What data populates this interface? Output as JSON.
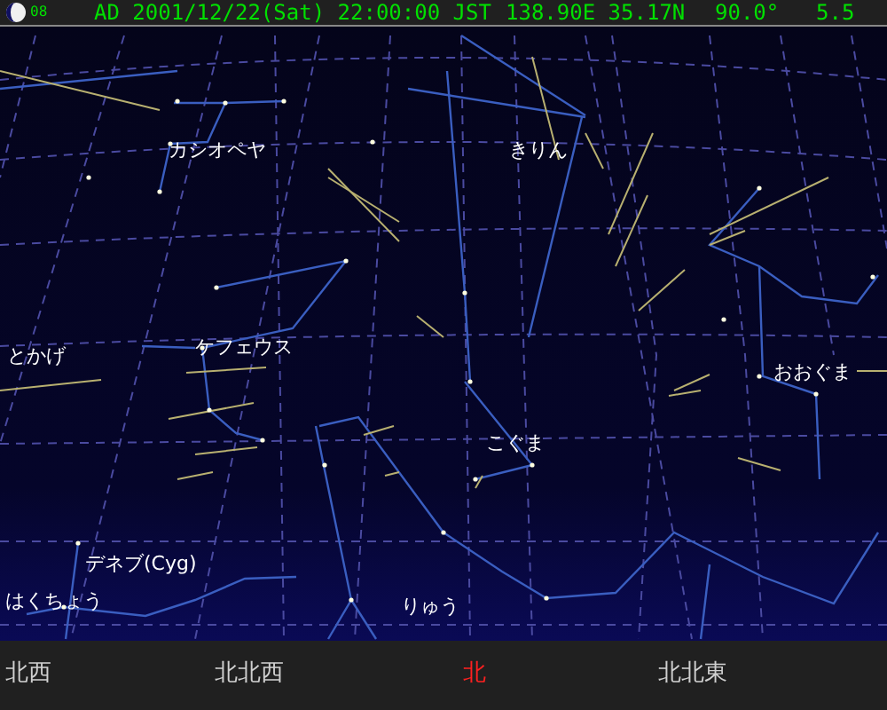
{
  "status_bar": {
    "moon_age": "08",
    "datetime": "AD 2001/12/22(Sat) 22:00:00 JST",
    "location": "138.90E 35.17N",
    "direction": "90.0°",
    "magnitude": "5.5"
  },
  "constellation_labels": [
    {
      "label": "カシオペヤ"
    },
    {
      "label": "きりん"
    },
    {
      "label": "とかげ"
    },
    {
      "label": "ケフェウス"
    },
    {
      "label": "おおぐま"
    },
    {
      "label": "こぐま"
    },
    {
      "label": "デネブ(Cyg)"
    },
    {
      "label": "はくちょう"
    },
    {
      "label": "りゅう"
    }
  ],
  "horizon_directions": [
    {
      "label": "北西",
      "highlighted": false
    },
    {
      "label": "北北西",
      "highlighted": false
    },
    {
      "label": "北",
      "highlighted": true
    },
    {
      "label": "北北東",
      "highlighted": false
    }
  ]
}
